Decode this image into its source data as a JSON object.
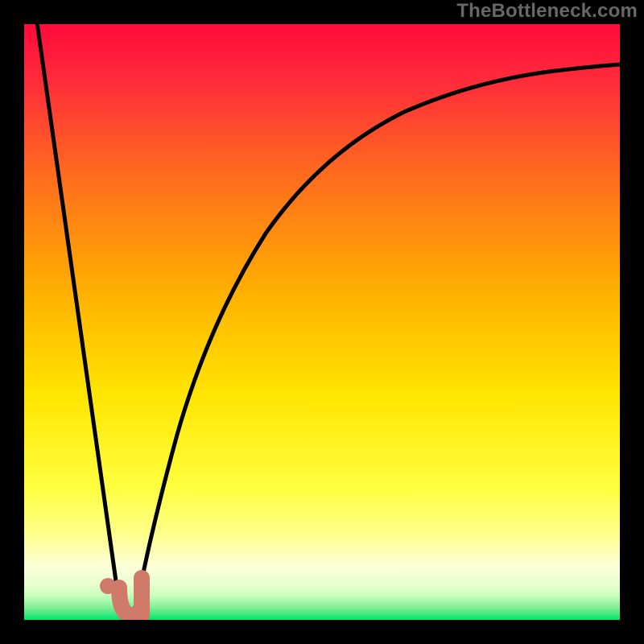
{
  "watermark": "TheBottleneck.com",
  "colors": {
    "background_black": "#000000",
    "gradient_top": "#ff0a3c",
    "gradient_mid1": "#ff6a1e",
    "gradient_mid2": "#ffd400",
    "gradient_low": "#ffff70",
    "gradient_pale": "#f6ffd6",
    "gradient_bottom": "#00e66a",
    "curve": "#000000",
    "marker": "#d07a6a"
  },
  "chart_data": {
    "type": "line",
    "title": "",
    "xlabel": "",
    "ylabel": "",
    "xlim": [
      0,
      100
    ],
    "ylim": [
      0,
      100
    ],
    "series": [
      {
        "name": "left-branch",
        "x": [
          0,
          15.5
        ],
        "y": [
          100,
          2
        ]
      },
      {
        "name": "right-branch",
        "x": [
          18,
          20,
          24,
          30,
          38,
          48,
          60,
          75,
          90,
          100
        ],
        "y": [
          1,
          7,
          22,
          42,
          60,
          73,
          82,
          88,
          91,
          93
        ]
      }
    ],
    "annotations": [
      {
        "name": "marker-dot",
        "x": 13.5,
        "y": 5
      },
      {
        "name": "marker-hook",
        "x": 17,
        "y": 2
      }
    ],
    "notes": "Bottleneck-style V curve on rainbow gradient; minimum around x≈16, right branch asymptotes near y≈93."
  }
}
